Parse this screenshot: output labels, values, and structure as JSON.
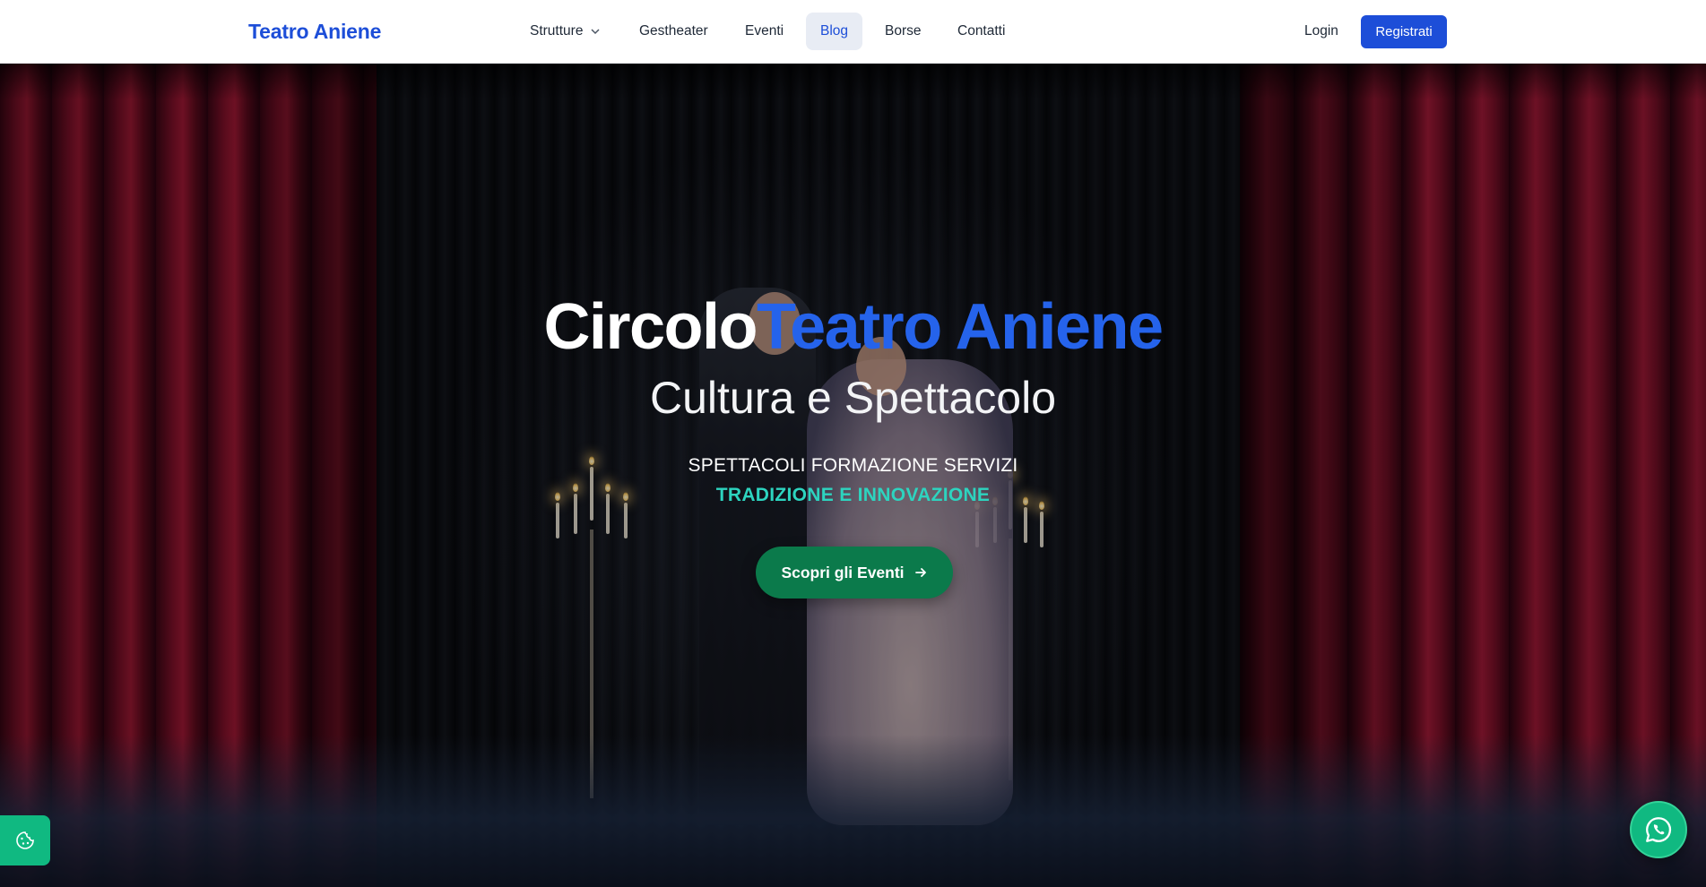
{
  "brand": {
    "name": "Teatro Aniene"
  },
  "nav": {
    "items": [
      {
        "label": "Strutture",
        "has_dropdown": true,
        "active": false
      },
      {
        "label": "Gestheater",
        "active": false
      },
      {
        "label": "Eventi",
        "active": false
      },
      {
        "label": "Blog",
        "active": true
      },
      {
        "label": "Borse",
        "active": false
      },
      {
        "label": "Contatti",
        "active": false
      }
    ],
    "login_label": "Login",
    "register_label": "Registrati"
  },
  "hero": {
    "title_main": "Circolo",
    "title_accent": "Teatro Aniene",
    "subtitle": "Cultura e Spettacolo",
    "tagline_1": "SPETTACOLI FORMAZIONE SERVIZI",
    "tagline_2": "TRADIZIONE E INNOVAZIONE",
    "cta_label": "Scopri gli Eventi"
  },
  "icons": {
    "dropdown": "chevron-down-icon",
    "cta": "arrow-right-icon",
    "cookie": "cookie-icon",
    "whatsapp": "whatsapp-icon"
  },
  "colors": {
    "brand": "#1d4ed8",
    "accent_title": "#2563eb",
    "tagline_accent": "#2dd4bf",
    "cta_bg": "#0b7a4b",
    "floating_green": "#10b981"
  }
}
